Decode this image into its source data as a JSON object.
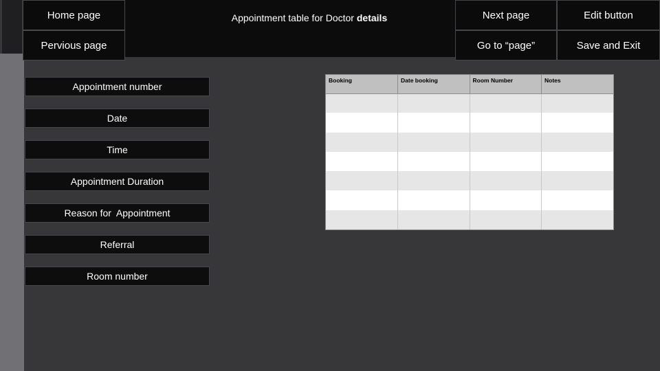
{
  "window": {
    "background_color": "#373739",
    "header_color": "#0c0c0c",
    "rail_color": "#707075"
  },
  "header": {
    "title_prefix": "Appointment table for Doctor ",
    "title_emphasis": "details",
    "nav_buttons": [
      {
        "label": "Home page",
        "name": "home-page-button"
      },
      {
        "label": "Pervious page",
        "name": "previous-page-button"
      }
    ],
    "action_buttons": [
      {
        "label": "Next page",
        "name": "next-page-button"
      },
      {
        "label": "Edit button",
        "name": "edit-button"
      },
      {
        "label": "Go to “page”",
        "name": "go-to-page-button"
      },
      {
        "label": "Save and Exit",
        "name": "save-and-exit-button"
      }
    ]
  },
  "sidebar": {
    "fields": [
      {
        "label": "Appointment number",
        "name": "field-appointment-number"
      },
      {
        "label": "Date",
        "name": "field-date"
      },
      {
        "label": "Time",
        "name": "field-time"
      },
      {
        "label": "Appointment Duration",
        "name": "field-appointment-duration"
      },
      {
        "label": "Reason for  Appointment",
        "name": "field-reason-for-appointment"
      },
      {
        "label": "Referral",
        "name": "field-referral"
      },
      {
        "label": "Room number",
        "name": "field-room-number"
      }
    ]
  },
  "table": {
    "headers": [
      "Booking",
      "Date booking",
      "Room Number",
      "Notes"
    ],
    "rows": [
      [
        "",
        "",
        "",
        ""
      ],
      [
        "",
        "",
        "",
        ""
      ],
      [
        "",
        "",
        "",
        ""
      ],
      [
        "",
        "",
        "",
        ""
      ],
      [
        "",
        "",
        "",
        ""
      ],
      [
        "",
        "",
        "",
        ""
      ],
      [
        "",
        "",
        "",
        ""
      ]
    ],
    "header_background": "#c0c0c0",
    "row_alt_background": "#e6e6e6",
    "row_background": "#ffffff"
  }
}
